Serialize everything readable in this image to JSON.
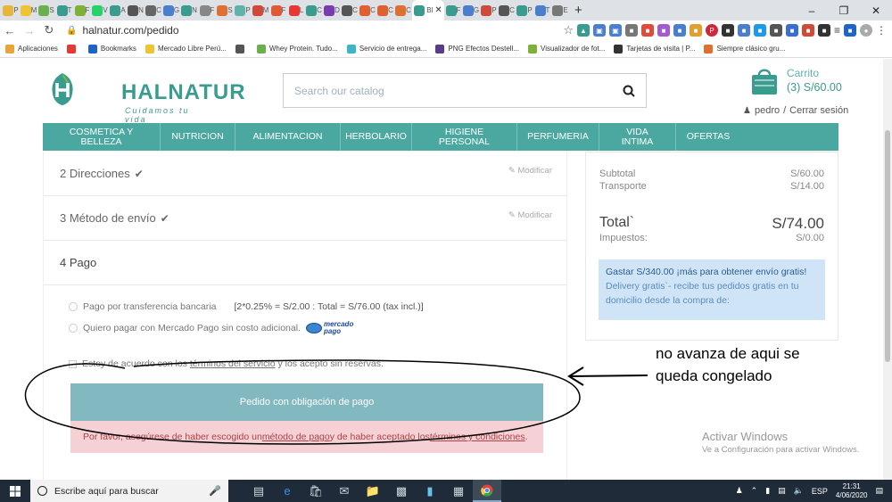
{
  "browser": {
    "tabs": [
      "P",
      "M",
      "S",
      "T",
      "F",
      "V",
      "A",
      "N",
      "C",
      "G",
      "N",
      "F",
      "S",
      "P",
      "M",
      "F",
      "L",
      "C",
      "D",
      "C",
      "C",
      "C",
      "C",
      "Bl",
      "F",
      "G",
      "P",
      "C",
      "P",
      "T",
      "E"
    ],
    "active_tab": "Bl",
    "url": "halnatur.com/pedido",
    "bookmarks": [
      {
        "label": "Aplicaciones",
        "color": "#e8a33a"
      },
      {
        "label": "",
        "color": "#e53935"
      },
      {
        "label": "Bookmarks",
        "color": "#1e63c8"
      },
      {
        "label": "Mercado Libre Perú...",
        "color": "#f0c430"
      },
      {
        "label": "",
        "color": "#555555"
      },
      {
        "label": "Whey Protein. Tudo...",
        "color": "#6ab04c"
      },
      {
        "label": "Servicio de entrega...",
        "color": "#3db5c8"
      },
      {
        "label": "PNG Efectos Destell...",
        "color": "#5a3a8a"
      },
      {
        "label": "Visualizador de fot...",
        "color": "#7fb03a"
      },
      {
        "label": "Tarjetas de visita | P...",
        "color": "#333333"
      },
      {
        "label": "Siempre clásico gru...",
        "color": "#e07030"
      }
    ]
  },
  "header": {
    "logo_main": "HALNATUR",
    "logo_sub": "Cuidamos tu vida",
    "search_placeholder": "Search our catalog",
    "cart_label": "Carrito",
    "cart_summary": "(3) S/60.00",
    "user": "pedro",
    "logout": "Cerrar sesión",
    "user_sep": "/",
    "menu": [
      "COSMETICA Y BELLEZA",
      "NUTRICION",
      "ALIMENTACION",
      "HERBOLARIO",
      "HIGIENE PERSONAL",
      "PERFUMERIA",
      "VIDA INTIMA",
      "OFERTAS"
    ]
  },
  "checkout": {
    "steps": [
      {
        "title": "2 Direcciones",
        "modify": "Modificar"
      },
      {
        "title": "3 Método de envío",
        "modify": "Modificar"
      }
    ],
    "current_step": "4 Pago",
    "option_transfer": "Pago por transferencia bancaria",
    "transfer_fee": "[2*0.25% = S/2.00 : Total = S/76.00 (tax incl.)]",
    "option_mercadopago": "Quiero pagar con Mercado Pago sin costo adicional.",
    "mp_logo_top": "mercado",
    "mp_logo_bottom": "pago",
    "terms_prefix": "Estoy de acuerdo con los ",
    "terms_link": "términos del servicio",
    "terms_suffix": " y los acepto sin reservas.",
    "order_button": "Pedido con obligación de pago",
    "alert_prefix": "Por favor, asegúrese de haber escogido un ",
    "alert_link1": "método de pago",
    "alert_mid": " y de haber aceptado los ",
    "alert_link2": "términos y condiciones",
    "alert_suffix": "."
  },
  "summary": {
    "subtotal_label": "Subtotal",
    "subtotal": "S/60.00",
    "shipping_label": "Transporte",
    "shipping": "S/14.00",
    "total_label": "Total`",
    "total": "S/74.00",
    "tax_label": "Impuestos:",
    "tax": "S/0.00",
    "free_ship_title": "Gastar S/340.00 ¡más para obtener envío gratis!",
    "free_ship_text": "Delivery gratis`- recibe tus pedidos gratis en tu domicilio desde la compra de:"
  },
  "annotation": {
    "line1": "no avanza de aqui se",
    "line2": "queda congelado"
  },
  "watermark": {
    "title": "Activar Windows",
    "subtitle": "Ve a Configuración para activar Windows."
  },
  "taskbar": {
    "search": "Escribe aquí para buscar",
    "lang": "ESP",
    "time": "21:31",
    "date": "4/06/2020"
  }
}
